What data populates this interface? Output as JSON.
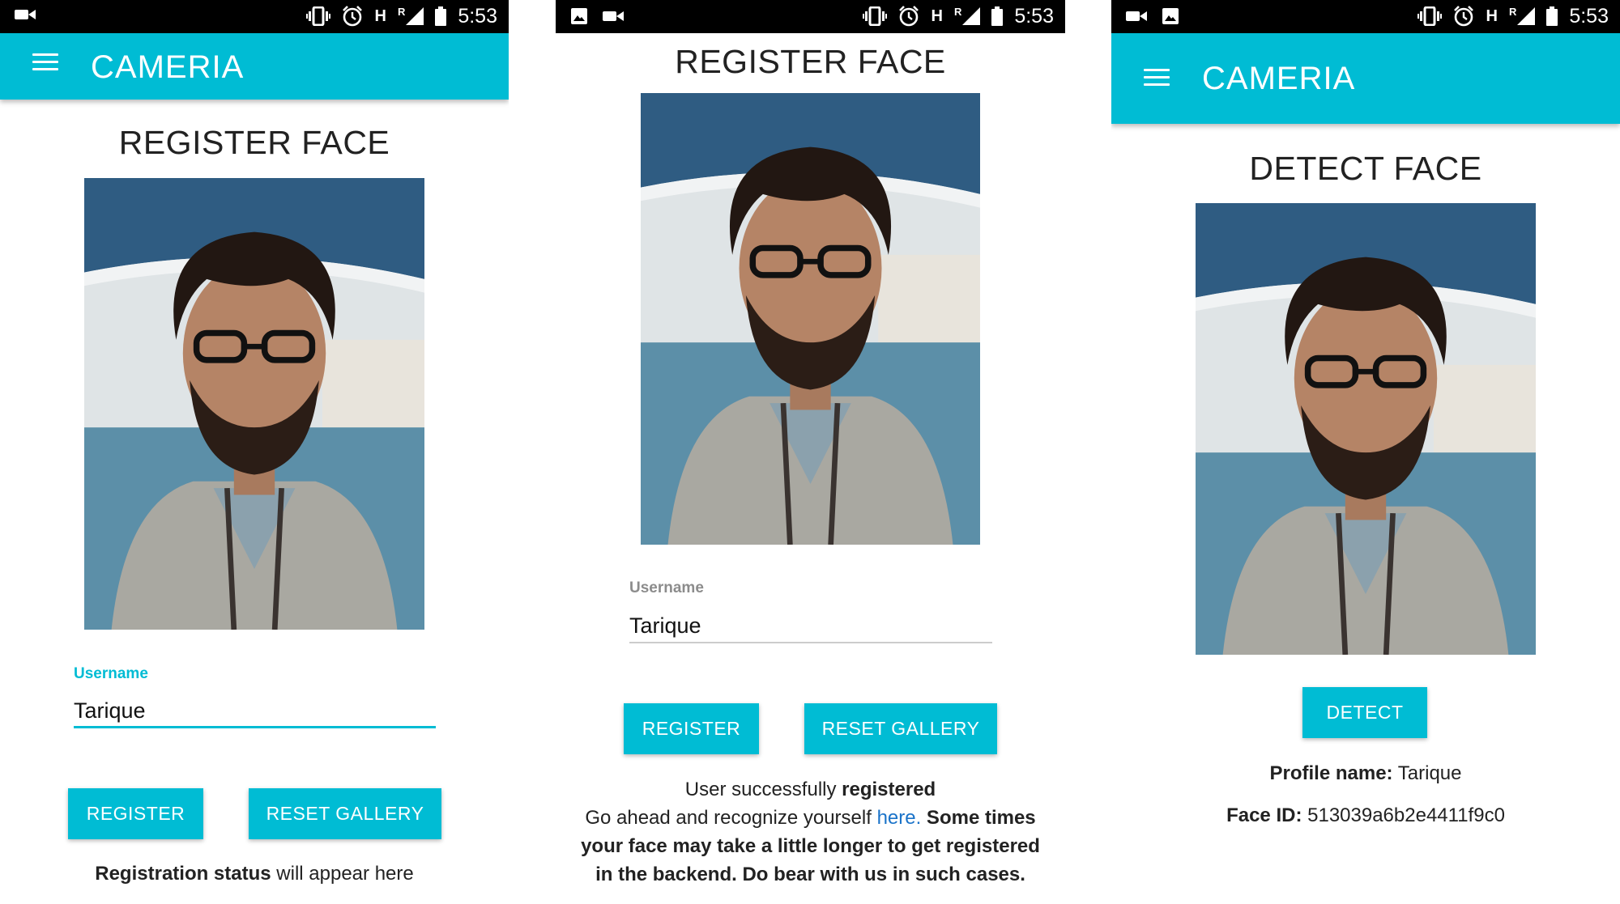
{
  "status_bar": {
    "time": "5:53",
    "network_letter": "H",
    "roaming_letter": "R"
  },
  "screens": [
    {
      "app_title": "CAMERIA",
      "heading": "REGISTER FACE",
      "username_label": "Username",
      "username_value": "Tarique",
      "register_label": "REGISTER",
      "reset_label": "RESET GALLERY",
      "status_bold": "Registration status",
      "status_rest": " will appear here"
    },
    {
      "heading": "REGISTER FACE",
      "username_label": "Username",
      "username_value": "Tarique",
      "register_label": "REGISTER",
      "reset_label": "RESET GALLERY",
      "msg_line1_plain": "User successfully ",
      "msg_line1_bold": "registered",
      "msg_line2_plain": "Go ahead and recognize yourself ",
      "msg_link": "here.",
      "msg_line2_bold": " Some times",
      "msg_line3": "your face may take a little longer to get registered",
      "msg_line4": "in the backend. Do bear with us in such cases."
    },
    {
      "app_title": "CAMERIA",
      "heading": "DETECT FACE",
      "detect_label": "DETECT",
      "profile_label": "Profile name:",
      "profile_value": " Tarique",
      "faceid_label": "Face ID:",
      "faceid_value": " 513039a6b2e4411f9c0"
    }
  ],
  "icons": {
    "status_left_p1": [
      "video-camera-icon"
    ],
    "status_left_p2": [
      "image-icon",
      "video-camera-icon"
    ],
    "status_left_p3": [
      "video-camera-icon",
      "image-icon"
    ],
    "status_right": [
      "vibrate-icon",
      "alarm-icon",
      "signal-icon",
      "battery-icon"
    ],
    "menu": "hamburger-menu-icon"
  },
  "colors": {
    "accent": "#00bcd4",
    "link": "#1a73c9",
    "status_bar": "#000000",
    "label_inactive": "#8c8c8c",
    "underline_inactive": "#cccccc"
  }
}
